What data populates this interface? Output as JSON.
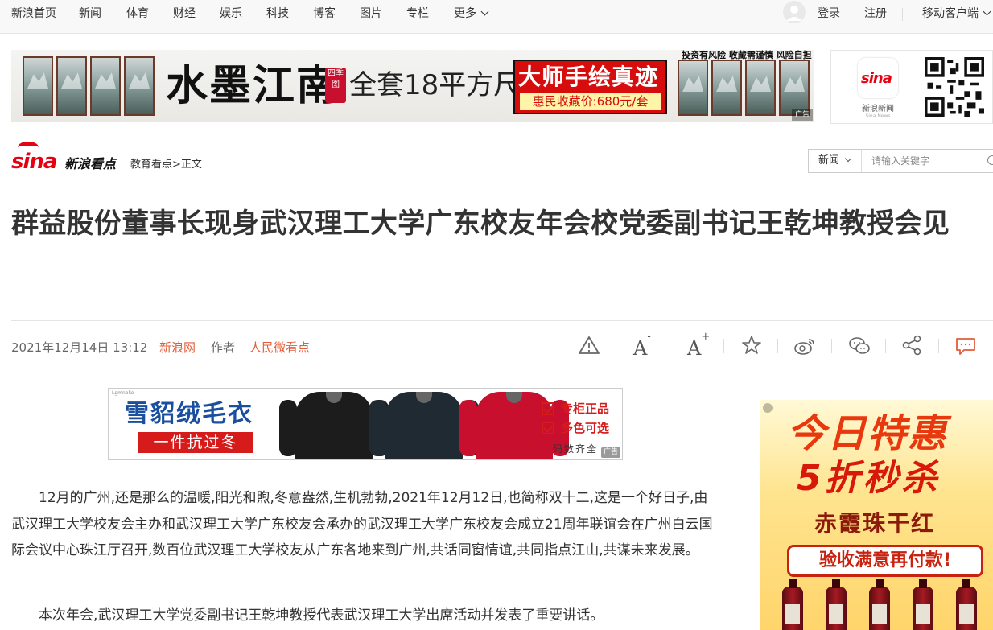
{
  "nav": {
    "items": [
      "新浪首页",
      "新闻",
      "体育",
      "财经",
      "娱乐",
      "科技",
      "博客",
      "图片",
      "专栏",
      "更多"
    ],
    "login": "登录",
    "register": "注册",
    "mobile": "移动客户端"
  },
  "banner_ad": {
    "title": "水墨江南",
    "seal": "四季图",
    "subtitle": "全套18平方尺",
    "headline": "大师手绘真迹",
    "price": "惠民收藏价:680元/套",
    "risk": "投资有风险 收藏需谨慎 风险自担",
    "tag": "广告"
  },
  "app_card": {
    "logo_text": "sina",
    "name": "新浪新闻",
    "sub": "Sina News"
  },
  "header": {
    "logo_text": "sina",
    "logo_suffix": "新浪看点",
    "breadcrumb": "教育看点>正文"
  },
  "search": {
    "scope": "新闻",
    "placeholder": "请输入关键字"
  },
  "article": {
    "title": "群益股份董事长现身武汉理工大学广东校友年会校党委副书记王乾坤教授会见",
    "date": "2021年12月14日 13:12",
    "source": "新浪网",
    "author_label": "作者",
    "author": "人民微看点",
    "font_a": "A",
    "minus": "-",
    "plus": "+",
    "paragraphs": [
      "12月的广州,还是那么的温暖,阳光和煦,冬意盎然,生机勃勃,2021年12月12日,也简称双十二,这是一个好日子,由武汉理工大学校友会主办和武汉理工大学广东校友会承办的武汉理工大学广东校友会成立21周年联谊会在广州白云国际会议中心珠江厅召开,数百位武汉理工大学校友从广东各地来到广州,共话同窗情谊,共同指点江山,共谋未来发展。",
      "本次年会,武汉理工大学党委副书记王乾坤教授代表武汉理工大学出席活动并发表了重要讲话。"
    ]
  },
  "inline_ad": {
    "brand": "Lgmnoke",
    "title": "雪貂绒毛衣",
    "subtitle": "一件抗过冬",
    "feature1": "专柜正品",
    "feature2": "多色可选",
    "sizes": "码数齐全",
    "tag": "广告",
    "colors": [
      "#1c1c1c",
      "#1f2a33",
      "#c8102e"
    ]
  },
  "side_ad": {
    "line1": "今日特惠",
    "line2": "5折秒杀",
    "line3": "赤霞珠干红",
    "line4": "验收满意再付款!"
  }
}
